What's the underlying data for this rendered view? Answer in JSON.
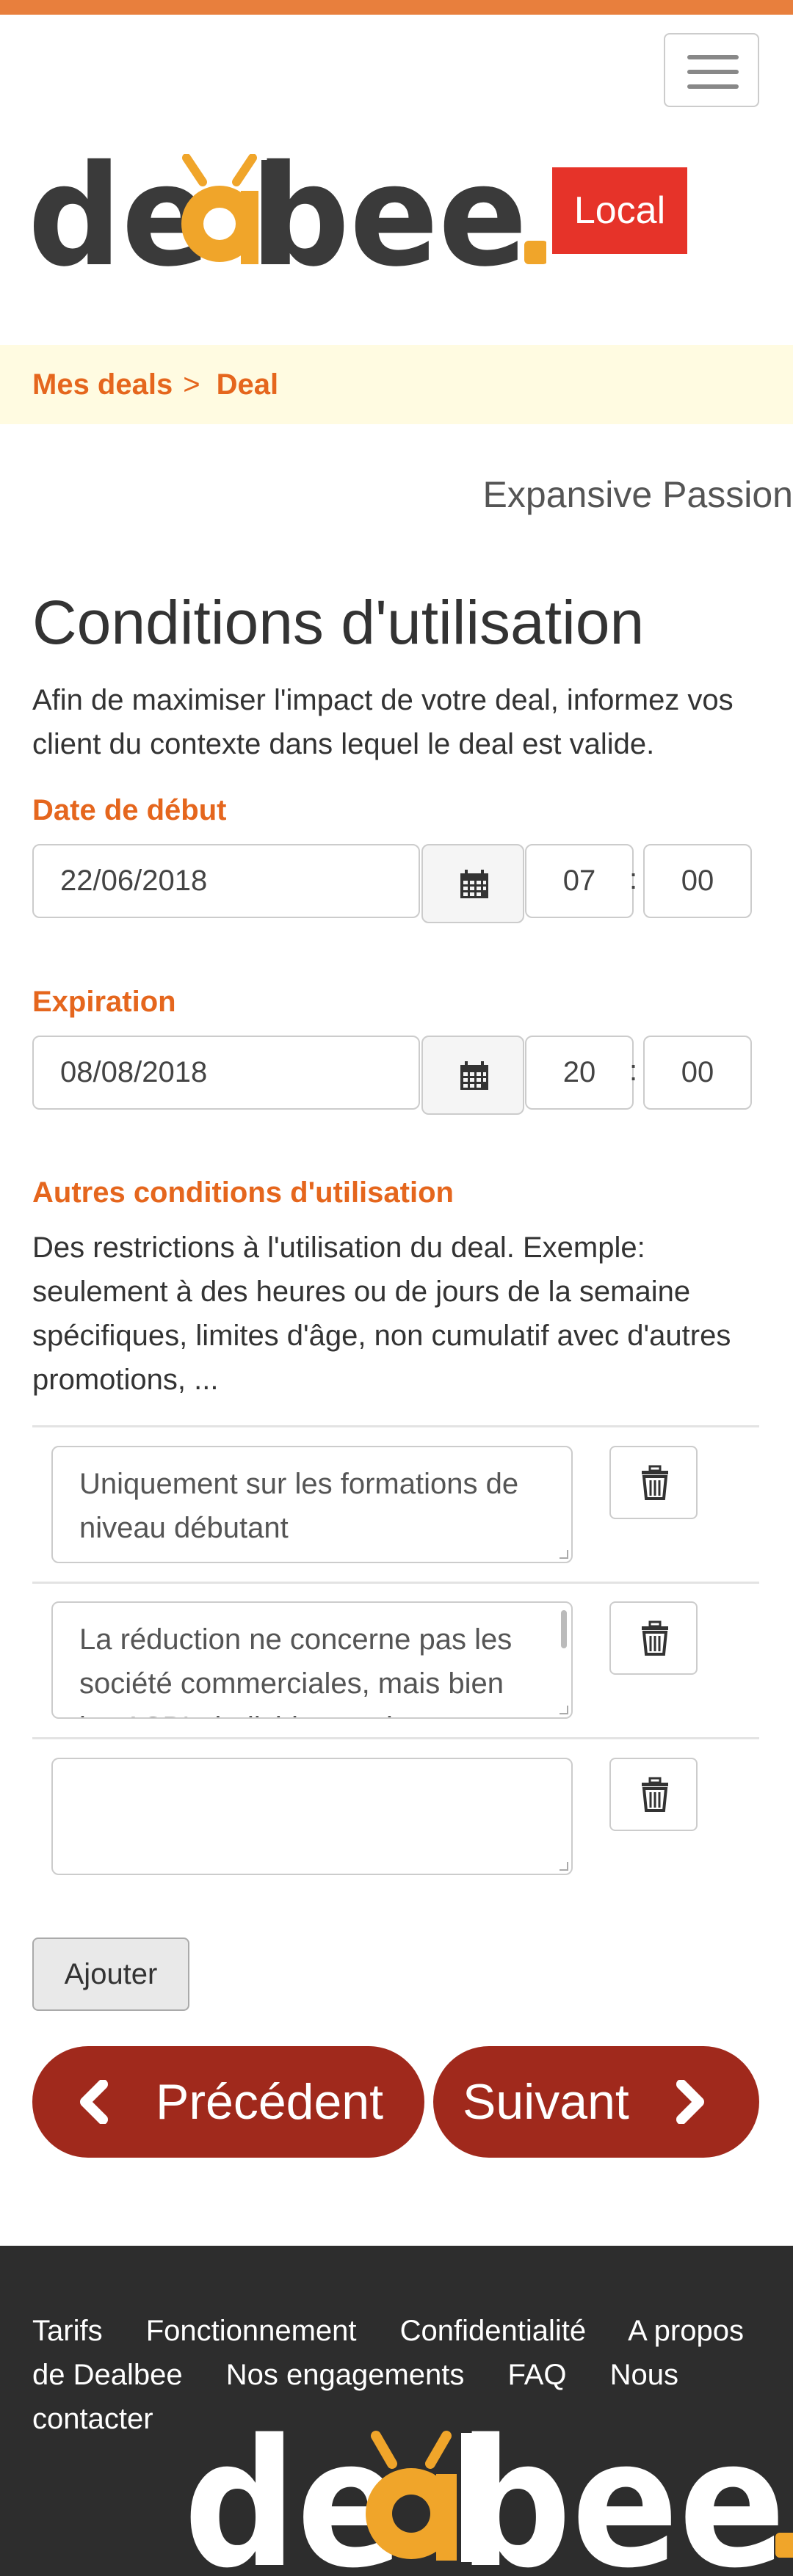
{
  "header": {
    "menu_icon": "hamburger-menu-icon",
    "logo_text": "dealbee",
    "badge": "Local",
    "accent_color": "#e87f3d"
  },
  "breadcrumb": {
    "items": [
      "Mes deals",
      "Deal"
    ],
    "separator": ">"
  },
  "company_name": "Expansive Passion",
  "page": {
    "title": "Conditions d'utilisation",
    "intro": "Afin de maximiser l'impact de votre deal, informez vos client du contexte dans lequel le deal est valide."
  },
  "start": {
    "label": "Date de début",
    "date": "22/06/2018",
    "hour": "07",
    "minute": "00"
  },
  "expiration": {
    "label": "Expiration",
    "date": "08/08/2018",
    "hour": "20",
    "minute": "00"
  },
  "time_separator": ":",
  "conditions": {
    "label": "Autres conditions d'utilisation",
    "description": "Des restrictions à l'utilisation du deal. Exemple: seulement à des heures ou de jours de la semaine spécifiques, limites d'âge, non cumulatif avec d'autres promotions, ...",
    "items": [
      "Uniquement sur les formations de niveau débutant",
      " La réduction ne concerne pas les société commerciales, mais bien les ASBL, individus, petits indépendants.",
      ""
    ],
    "add_label": "Ajouter"
  },
  "nav": {
    "prev_label": "Précédent",
    "next_label": "Suivant",
    "button_color": "#a0291c"
  },
  "footer": {
    "links": [
      "Tarifs",
      "Fonctionnement",
      "Confidentialité",
      "A propos de Dealbee",
      "Nos engagements",
      "FAQ",
      "Nous contacter"
    ],
    "logo_text": "dealbee"
  }
}
